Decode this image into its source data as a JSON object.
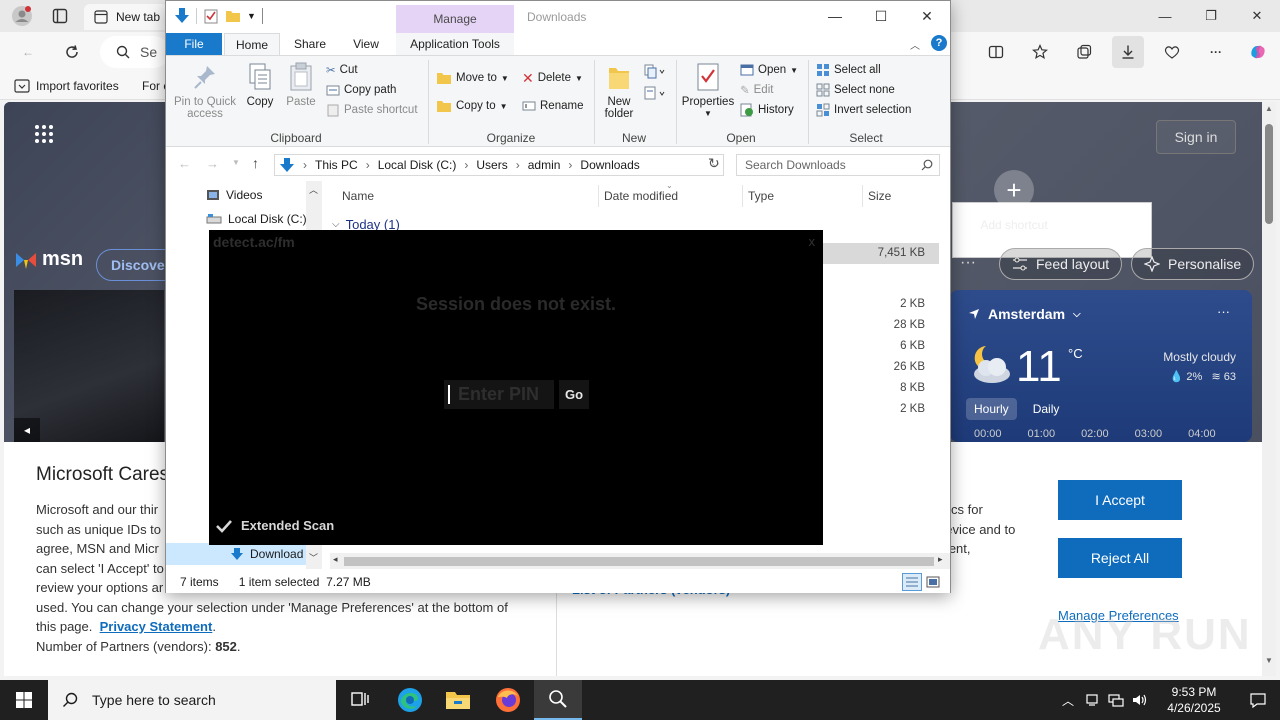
{
  "browser": {
    "tab_title": "New tab",
    "favorites": [
      "Import favorites",
      "For c"
    ],
    "search_placeholder": "Se"
  },
  "ntp": {
    "sign_in": "Sign in",
    "add_shortcut": "Add shortcut",
    "msn": "msn",
    "discover": "Discover",
    "feed_layout": "Feed layout",
    "personalise": "Personalise",
    "weather": {
      "location": "Amsterdam",
      "temp": "11",
      "unit": "°C",
      "condition": "Mostly cloudy",
      "rain": "2%",
      "wind": "63",
      "tabs": [
        "Hourly",
        "Daily"
      ],
      "hours": [
        "00:00",
        "01:00",
        "02:00",
        "03:00",
        "04:00"
      ]
    }
  },
  "consent": {
    "title": "Microsoft Cares",
    "body_1": "Microsoft and our thir",
    "body_2": "such as unique IDs to",
    "body_3": "agree, MSN and Micr",
    "body_4": "can select 'I Accept' to",
    "body_5": "review your options ar",
    "body_6": "used. You can change your selection under 'Manage Preferences' at the bottom of",
    "body_7": "this page.",
    "privacy_link": "Privacy Statement",
    "partners_label": "Number of Partners (vendors):",
    "partners_count": "852",
    "mid_1": "stics for",
    "mid_2": "device and to",
    "mid_3": "ment,",
    "mid_link": "List of Partners (vendors)",
    "accept": "I Accept",
    "reject": "Reject All",
    "manage": "Manage Preferences"
  },
  "explorer": {
    "title": "Downloads",
    "manage_tab": "Manage",
    "tabs": [
      "File",
      "Home",
      "Share",
      "View",
      "Application Tools"
    ],
    "clipboard": {
      "label": "Clipboard",
      "pin": "Pin to Quick access",
      "copy": "Copy",
      "paste": "Paste",
      "cut": "Cut",
      "copy_path": "Copy path",
      "paste_shortcut": "Paste shortcut"
    },
    "organize": {
      "label": "Organize",
      "move_to": "Move to",
      "copy_to": "Copy to",
      "delete": "Delete",
      "rename": "Rename"
    },
    "new": {
      "label": "New",
      "new_folder": "New folder"
    },
    "open": {
      "label": "Open",
      "properties": "Properties",
      "open": "Open",
      "edit": "Edit",
      "history": "History"
    },
    "select": {
      "label": "Select",
      "select_all": "Select all",
      "select_none": "Select none",
      "invert": "Invert selection"
    },
    "path": [
      "This PC",
      "Local Disk (C:)",
      "Users",
      "admin",
      "Downloads"
    ],
    "search_placeholder": "Search Downloads",
    "nav_items": [
      "Videos",
      "Local Disk (C:)",
      "Download"
    ],
    "columns": [
      "Name",
      "Date modified",
      "Type",
      "Size"
    ],
    "group": "Today (1)",
    "sizes": [
      "7,451 KB",
      "2 KB",
      "28 KB",
      "6 KB",
      "26 KB",
      "8 KB",
      "2 KB"
    ],
    "status_items": "7 items",
    "status_selected": "1 item selected",
    "status_size": "7.27 MB"
  },
  "overlay": {
    "title": "detect.ac/fm",
    "close": "x",
    "message": "Session does not exist.",
    "pin_placeholder": "Enter PIN",
    "go": "Go",
    "extended_scan": "Extended Scan"
  },
  "taskbar": {
    "search_placeholder": "Type here to search",
    "time": "9:53 PM",
    "date": "4/26/2025"
  },
  "watermark": "ANY RUN"
}
